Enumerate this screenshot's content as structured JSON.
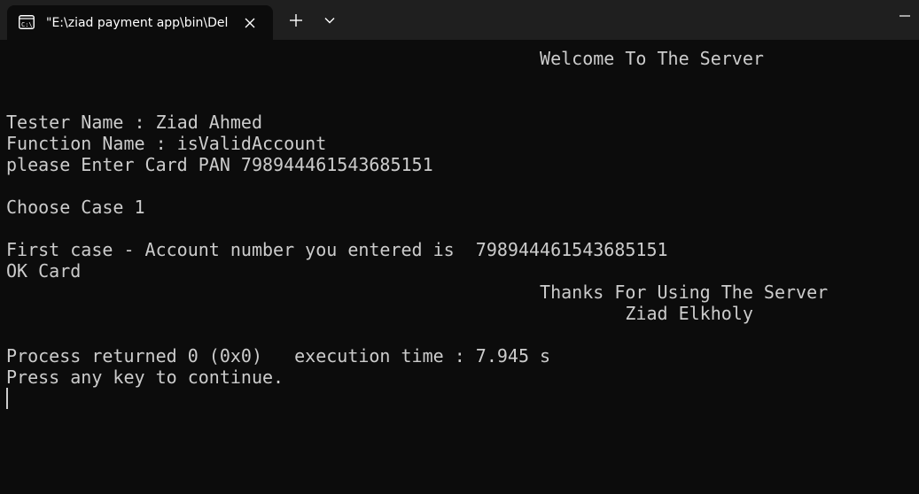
{
  "tab": {
    "title": "\"E:\\ziad payment app\\bin\\Del",
    "icon": "terminal-icon",
    "close_icon": "close-icon"
  },
  "toolbar": {
    "new_tab_icon": "plus-icon",
    "dropdown_icon": "chevron-down-icon",
    "minimize_icon": "minimize-icon"
  },
  "colors": {
    "background": "#0c0c0c",
    "titlebar": "#1f1f1f",
    "text": "#cccccc"
  },
  "console": {
    "lines": [
      "                                                  Welcome To The Server",
      "",
      "",
      "Tester Name : Ziad Ahmed",
      "Function Name : isValidAccount",
      "please Enter Card PAN 798944461543685151",
      "",
      "Choose Case 1",
      "",
      "First case - Account number you entered is  798944461543685151",
      "OK Card",
      "                                                  Thanks For Using The Server",
      "                                                          Ziad Elkholy",
      "",
      "Process returned 0 (0x0)   execution time : 7.945 s",
      "Press any key to continue."
    ]
  }
}
